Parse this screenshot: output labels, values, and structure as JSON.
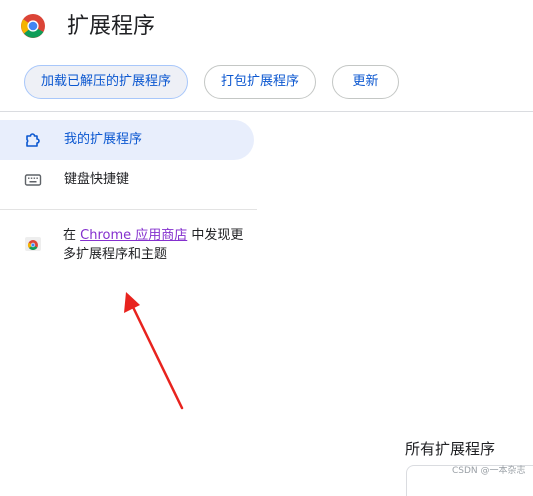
{
  "header": {
    "title": "扩展程序",
    "logo_icon": "chrome-logo-icon"
  },
  "toolbar": {
    "load_unpacked_label": "加载已解压的扩展程序",
    "pack_label": "打包扩展程序",
    "update_label": "更新"
  },
  "sidebar": {
    "items": [
      {
        "label": "我的扩展程序",
        "icon": "puzzle-icon",
        "active": true
      },
      {
        "label": "键盘快捷键",
        "icon": "keyboard-icon",
        "active": false
      }
    ],
    "store_promo": {
      "prefix": "在 ",
      "link": "Chrome 应用商店",
      "suffix": " 中发现更多扩展程序和主题",
      "icon": "chrome-web-store-icon"
    }
  },
  "main": {
    "section_heading": "所有扩展程序"
  },
  "watermark": "CSDN @一本杂志",
  "colors": {
    "accent": "#0b57d0",
    "active_bg": "#e8eefc",
    "link_visited": "#8430ce",
    "arrow": "#e8231e"
  }
}
